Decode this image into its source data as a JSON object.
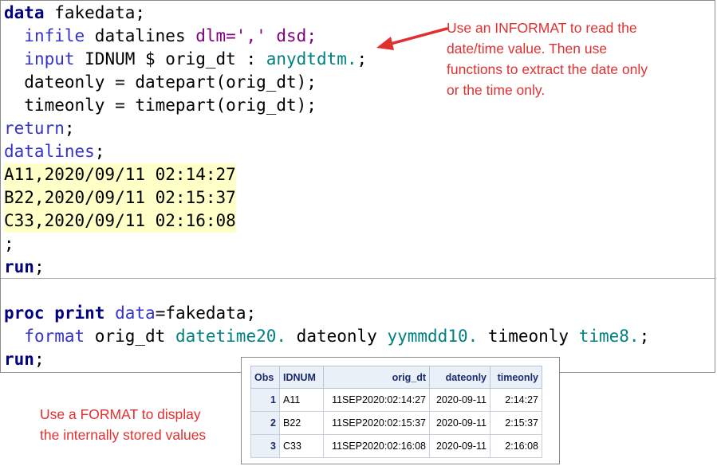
{
  "code": {
    "l1_kw": "data",
    "l1_rest": " fakedata;",
    "l2_ind": "  ",
    "l2_kw": "infile",
    "l2_mid": " datalines ",
    "l2_opt": "dlm=','",
    "l2_end": " dsd;",
    "l3_ind": "  ",
    "l3_kw": "input",
    "l3_mid": " IDNUM $ orig_dt : ",
    "l3_fmt": "anydtdtm.",
    "l3_end": ";",
    "l4": "  dateonly = datepart(orig_dt);",
    "l5": "  timeonly = timepart(orig_dt);",
    "l6_kw": "return",
    "l6_end": ";",
    "l7_kw": "datalines",
    "l7_end": ";",
    "d1": "A11,2020/09/11 02:14:27",
    "d2": "B22,2020/09/11 02:15:37",
    "d3": "C33,2020/09/11 02:16:08",
    "l11": ";",
    "l12_kw": "run",
    "l12_end": ";",
    "p1_kw": "proc",
    "p1_kw2": "print",
    "p1_opt": "data",
    "p1_end": "=fakedata;",
    "p2_ind": "  ",
    "p2_kw": "format",
    "p2_a": " orig_dt ",
    "p2_f1": "datetime20.",
    "p2_b": " dateonly ",
    "p2_f2": "yymmdd10.",
    "p2_c": " timeonly ",
    "p2_f3": "time8.",
    "p2_end": ";",
    "p3_kw": "run",
    "p3_end": ";"
  },
  "notes": {
    "informat_1": "Use an INFORMAT to read the",
    "informat_2": "date/time value. Then use",
    "informat_3": "functions to extract the date only",
    "informat_4": "or the time only.",
    "format_1": "Use a FORMAT to display",
    "format_2": "the internally stored values"
  },
  "arrow_color": "#e03030",
  "output_table": {
    "headers": [
      "Obs",
      "IDNUM",
      "orig_dt",
      "dateonly",
      "timeonly"
    ],
    "rows": [
      [
        "1",
        "A11",
        "11SEP2020:02:14:27",
        "2020-09-11",
        "2:14:27"
      ],
      [
        "2",
        "B22",
        "11SEP2020:02:15:37",
        "2020-09-11",
        "2:15:37"
      ],
      [
        "3",
        "C33",
        "11SEP2020:02:16:08",
        "2020-09-11",
        "2:16:08"
      ]
    ]
  }
}
